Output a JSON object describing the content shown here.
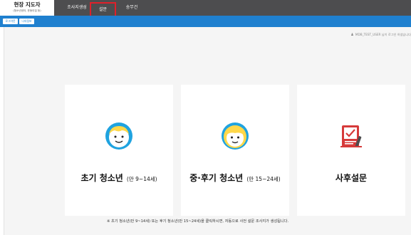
{
  "header": {
    "brand_title": "현장 지도자",
    "brand_subtitle": "(청소년센터, 운동이집 등)",
    "nav": [
      {
        "label": "조사지생성"
      },
      {
        "label": "설문"
      },
      {
        "label": "송무건"
      }
    ],
    "active_nav_index": 1
  },
  "subbar": {
    "buttons": [
      {
        "label": "로그아웃"
      },
      {
        "label": "나의정보"
      }
    ]
  },
  "user_note": "MDB_TEST_USER 님이 로그인 하셨습니다",
  "cards": [
    {
      "title": "초기 청소년",
      "range": "(만 9~14세)",
      "icon": "boy-face-icon"
    },
    {
      "title": "중·후기 청소년",
      "range": "(만 15~24세)",
      "icon": "girl-face-icon"
    },
    {
      "title": "사후설문",
      "range": "",
      "icon": "survey-document-icon"
    }
  ],
  "footer_note": "※ 초기 청소년(만 9~14세) 또는 후기 청소년(만 15~24세)을 클릭하시면, 자동으로 사전 설문 조사지가 생성됩니다.",
  "colors": {
    "nav_bg": "#4d4d4f",
    "subbar_bg": "#1f80cf",
    "active_outline": "#e0202a",
    "face_blue": "#1fa3e0",
    "face_yellow": "#ffd84a",
    "doc_red": "#d63a3a"
  }
}
